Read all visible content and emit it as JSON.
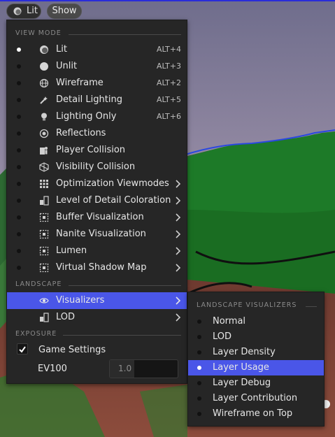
{
  "toolbar": {
    "view_mode_label": "Lit",
    "show_label": "Show"
  },
  "menu": {
    "view_mode_heading": "VIEW MODE",
    "view_modes": [
      {
        "label": "Lit",
        "shortcut": "ALT+4",
        "icon": "lit-sphere-icon",
        "active": true
      },
      {
        "label": "Unlit",
        "shortcut": "ALT+3",
        "icon": "unlit-sphere-icon"
      },
      {
        "label": "Wireframe",
        "shortcut": "ALT+2",
        "icon": "wireframe-globe-icon"
      },
      {
        "label": "Detail Lighting",
        "shortcut": "ALT+5",
        "icon": "detail-lighting-icon"
      },
      {
        "label": "Lighting Only",
        "shortcut": "ALT+6",
        "icon": "bulb-icon"
      },
      {
        "label": "Reflections",
        "shortcut": "",
        "icon": "reflections-icon"
      },
      {
        "label": "Player Collision",
        "shortcut": "",
        "icon": "player-collision-icon"
      },
      {
        "label": "Visibility Collision",
        "shortcut": "",
        "icon": "visibility-collision-icon"
      },
      {
        "label": "Optimization Viewmodes",
        "submenu": true,
        "icon": "grid-icon"
      },
      {
        "label": "Level of Detail Coloration",
        "submenu": true,
        "icon": "lod-coloration-icon"
      },
      {
        "label": "Buffer Visualization",
        "submenu": true,
        "icon": "buffer-icon"
      },
      {
        "label": "Nanite Visualization",
        "submenu": true,
        "icon": "nanite-icon"
      },
      {
        "label": "Lumen",
        "submenu": true,
        "icon": "lumen-icon"
      },
      {
        "label": "Virtual Shadow Map",
        "submenu": true,
        "icon": "shadow-map-icon"
      }
    ],
    "landscape_heading": "LANDSCAPE",
    "landscape_items": [
      {
        "label": "Visualizers",
        "submenu": true,
        "selected": true,
        "icon": "visualizers-icon"
      },
      {
        "label": "LOD",
        "submenu": true,
        "icon": "lod-icon"
      }
    ],
    "exposure_heading": "EXPOSURE",
    "game_settings_label": "Game Settings",
    "game_settings_checked": true,
    "ev100_label": "EV100",
    "ev100_value": "1.0"
  },
  "submenu": {
    "heading": "LANDSCAPE VISUALIZERS",
    "items": [
      {
        "label": "Normal"
      },
      {
        "label": "LOD"
      },
      {
        "label": "Layer Density"
      },
      {
        "label": "Layer Usage",
        "selected": true
      },
      {
        "label": "Layer Debug"
      },
      {
        "label": "Layer Contribution"
      },
      {
        "label": "Wireframe on Top"
      }
    ]
  },
  "colors": {
    "menu_bg": "#262626",
    "highlight": "#4a56e8",
    "sky": "#a89ab0",
    "grass": "#1f7a2a",
    "dirt": "#8a4a3a"
  }
}
